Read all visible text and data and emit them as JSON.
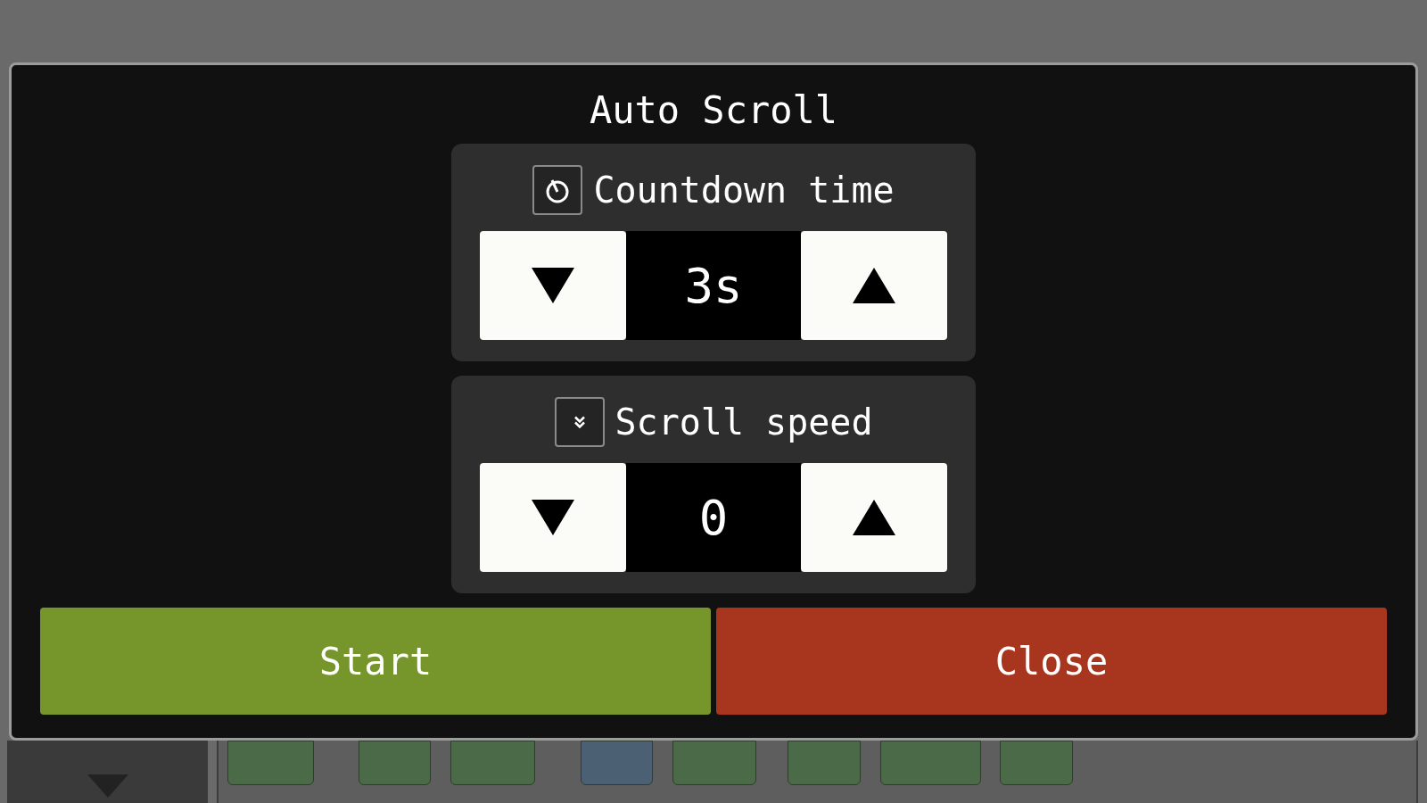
{
  "dialog": {
    "title": "Auto Scroll",
    "settings": [
      {
        "kind": "timer",
        "label": "Countdown time",
        "value": "3s"
      },
      {
        "kind": "speed",
        "label": "Scroll speed",
        "value": "0"
      }
    ],
    "buttons": [
      {
        "kind": "start",
        "label": "Start"
      },
      {
        "kind": "close",
        "label": "Close"
      }
    ]
  },
  "background": {
    "notes": [
      {
        "color": "#4b6a48"
      },
      {
        "color": "#4b6a48"
      },
      {
        "color": "#4b6a48"
      },
      {
        "color": "#4c6074"
      },
      {
        "color": "#4b6a48"
      },
      {
        "color": "#4b6a48"
      },
      {
        "color": "#4b6a48"
      },
      {
        "color": "#4b6a48"
      }
    ]
  }
}
